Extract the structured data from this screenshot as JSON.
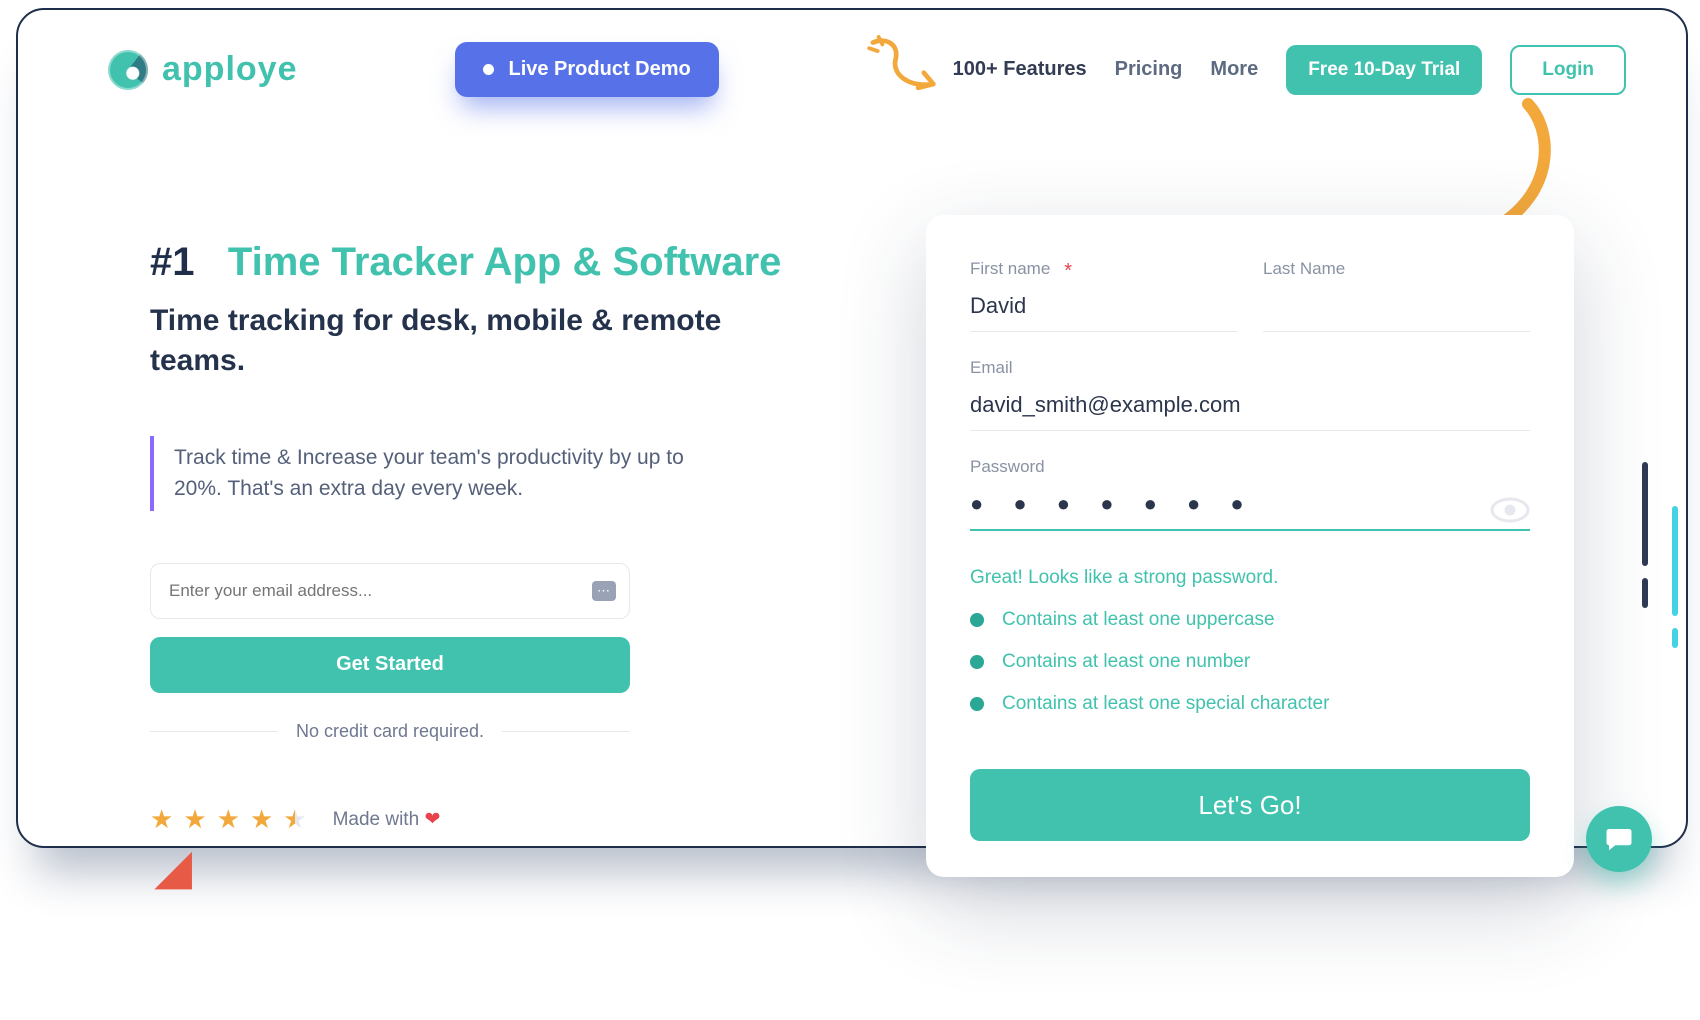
{
  "brand": {
    "name": "apploye"
  },
  "nav": {
    "demo": "Live Product Demo",
    "features": "100+ Features",
    "pricing": "Pricing",
    "more": "More",
    "trial": "Free 10-Day Trial",
    "login": "Login"
  },
  "hero": {
    "hash": "#1",
    "title_teal": "Time Tracker App & Software",
    "subtitle": "Time tracking for desk, mobile & remote teams.",
    "quote": "Track time & Increase your team's productivity by up to 20%. That's an extra day every week.",
    "email_placeholder": "Enter your email address...",
    "cta": "Get Started",
    "nocard": "No credit card required.",
    "madewith": "Made with",
    "rating_stars": 4.5
  },
  "signup": {
    "labels": {
      "first_name": "First name",
      "last_name": "Last Name",
      "email": "Email",
      "password": "Password"
    },
    "values": {
      "first_name": "David",
      "last_name": "",
      "email": "david_smith@example.com",
      "password_masked": "● ● ● ● ● ● ●"
    },
    "strength_msg": "Great! Looks like a strong password.",
    "rules": {
      "uppercase": "Contains at least one uppercase",
      "number": "Contains at least one number",
      "special": "Contains at least one special character"
    },
    "submit": "Let's Go!"
  },
  "colors": {
    "teal": "#41c2ae",
    "blue": "#5772e8",
    "orange": "#f2a83b",
    "navy": "#1f2e4a"
  }
}
